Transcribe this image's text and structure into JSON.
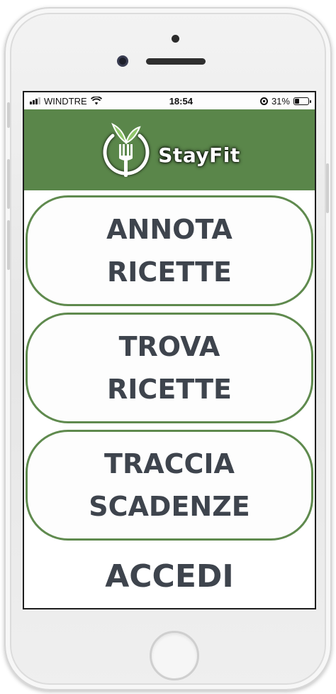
{
  "status_bar": {
    "carrier": "WINDTRE",
    "time": "18:54",
    "battery_percent": "31%",
    "battery_level": 0.31,
    "icons": [
      "signal-icon",
      "wifi-icon",
      "rotation-lock-icon",
      "battery-icon"
    ]
  },
  "header": {
    "brand": "StayFit",
    "logo_icon": "fork-leaf-logo-icon",
    "background_color": "#5a864a"
  },
  "menu": {
    "annota_label": "ANNOTA\nRICETTE",
    "trova_label": "TROVA\nRICETTE",
    "traccia_label": "TRACCIA\nSCADENZE",
    "accedi_label": "ACCEDI"
  },
  "colors": {
    "accent_green": "#5f8a4e",
    "label_text": "#3e444d"
  }
}
